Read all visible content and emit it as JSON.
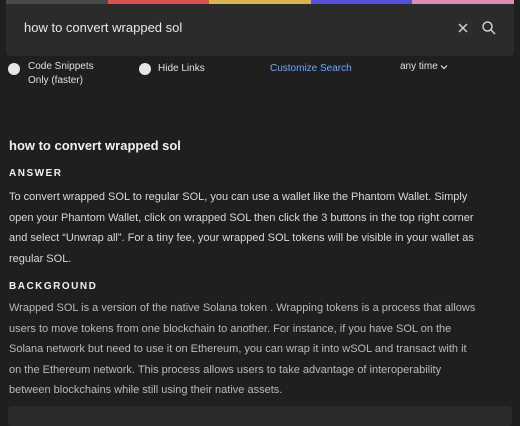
{
  "search": {
    "query": "how to convert wrapped sol",
    "clear_icon": "close-icon",
    "search_icon": "search-icon"
  },
  "colors": {
    "strip": [
      "#4a4a4a",
      "#d9534f",
      "#d9b34f",
      "#5a4fd9",
      "#d98fb0"
    ],
    "accent_link": "#6ea8ff"
  },
  "options": {
    "code_snippets_line1": "Code Snippets",
    "code_snippets_line2": "Only (faster)",
    "hide_links": "Hide Links",
    "customize": "Customize Search",
    "time": "any time",
    "time_icon": "chevron-down-icon"
  },
  "result": {
    "title": "how to convert wrapped sol",
    "answer_heading": "ANSWER",
    "answer_lines": [
      "To convert wrapped SOL to regular SOL, you can use a wallet like the Phantom Wallet. Simply",
      "open your Phantom Wallet, click on wrapped SOL then click the 3 buttons in the top right corner",
      "and select “Unwrap all”. For a tiny fee, your wrapped SOL tokens will be visible in your wallet as",
      "regular SOL."
    ],
    "background_heading": "BACKGROUND",
    "background_lines": [
      "Wrapped SOL is a version of the native Solana token . Wrapping tokens is a process that allows",
      "users to move tokens from one blockchain to another. For instance, if you have SOL on the",
      "Solana network but need to use it on Ethereum, you can wrap it into wSOL and transact with it",
      "on the Ethereum network. This process allows users to take advantage of interoperability",
      "between blockchains while still using their native assets."
    ]
  }
}
